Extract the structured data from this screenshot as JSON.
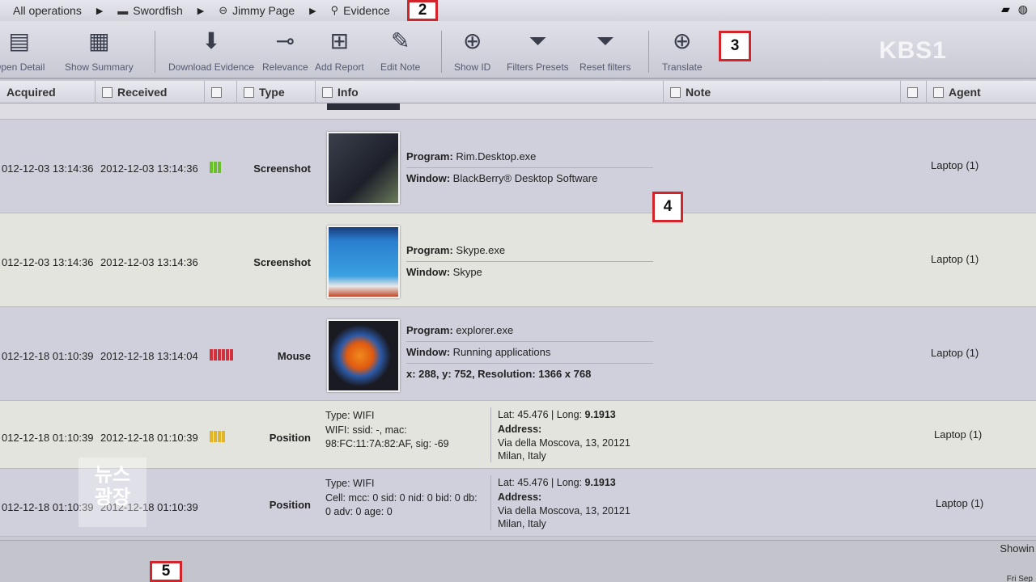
{
  "breadcrumb": {
    "items": [
      {
        "label": "All operations",
        "icon": "none"
      },
      {
        "label": "Swordfish",
        "icon": "folder-icon"
      },
      {
        "label": "Jimmy Page",
        "icon": "target-icon"
      },
      {
        "label": "Evidence",
        "icon": "search-icon"
      }
    ]
  },
  "toolbar": {
    "buttons": [
      {
        "label": "Open Detail"
      },
      {
        "label": "Show Summary"
      },
      {
        "label": "Download Evidence"
      },
      {
        "label": "Relevance"
      },
      {
        "label": "Add Report"
      },
      {
        "label": "Edit Note"
      },
      {
        "label": "Show ID"
      },
      {
        "label": "Filters Presets"
      },
      {
        "label": "Reset filters"
      },
      {
        "label": "Translate"
      }
    ]
  },
  "watermark": "KBS1",
  "markers": {
    "m2": "2",
    "m3": "3",
    "m4": "4",
    "m5": "5"
  },
  "columns": {
    "acquired": "Acquired",
    "received": "Received",
    "type": "Type",
    "info": "Info",
    "note": "Note",
    "agent": "Agent"
  },
  "rows": [
    {
      "acquired": "012-12-03 13:14:36",
      "received": "2012-12-03 13:14:36",
      "relevance_color": "#6bbf2a",
      "type": "Screenshot",
      "program_label": "Program:",
      "program": "Rim.Desktop.exe",
      "window_label": "Window:",
      "window": "BlackBerry® Desktop Software",
      "agent": "Laptop (1)"
    },
    {
      "acquired": "012-12-03 13:14:36",
      "received": "2012-12-03 13:14:36",
      "type": "Screenshot",
      "program_label": "Program:",
      "program": "Skype.exe",
      "window_label": "Window:",
      "window": "Skype",
      "agent": "Laptop (1)"
    },
    {
      "acquired": "012-12-18 01:10:39",
      "received": "2012-12-18 13:14:04",
      "relevance_color": "#d2303a",
      "type": "Mouse",
      "program_label": "Program:",
      "program": "explorer.exe",
      "window_label": "Window:",
      "window": "Running applications",
      "coords": "x: 288, y: 752, Resolution: 1366 x 768",
      "agent": "Laptop (1)"
    },
    {
      "acquired": "012-12-18 01:10:39",
      "received": "2012-12-18 01:10:39",
      "relevance_color": "#e0b52a",
      "type": "Position",
      "type_line": "Type: WIFI",
      "detail_1": "WIFI: ssid: -, mac:",
      "detail_2": "98:FC:11:7A:82:AF, sig: -69",
      "latlong_label": "Lat: 45.476 | Long:",
      "long_value": "9.1913",
      "address_label": "Address:",
      "address_1": "Via della Moscova, 13, 20121",
      "address_2": "Milan, Italy",
      "agent": "Laptop (1)"
    },
    {
      "acquired": "012-12-18 01:10:39",
      "received": "2012-12-18 01:10:39",
      "type": "Position",
      "type_line": "Type: WIFI",
      "detail_1": "Cell: mcc: 0 sid: 0 nid: 0 bid: 0 db:",
      "detail_2": "0 adv: 0 age: 0",
      "latlong_label": "Lat: 45.476 | Long:",
      "long_value": "9.1913",
      "address_label": "Address:",
      "address_1": "Via della Moscova, 13, 20121",
      "address_2": "Milan, Italy",
      "agent": "Laptop (1)"
    }
  ],
  "footer": {
    "showing": "Showin",
    "date": "Fri Sep"
  },
  "news_logo": {
    "line1": "뉴스",
    "line2": "광장"
  }
}
